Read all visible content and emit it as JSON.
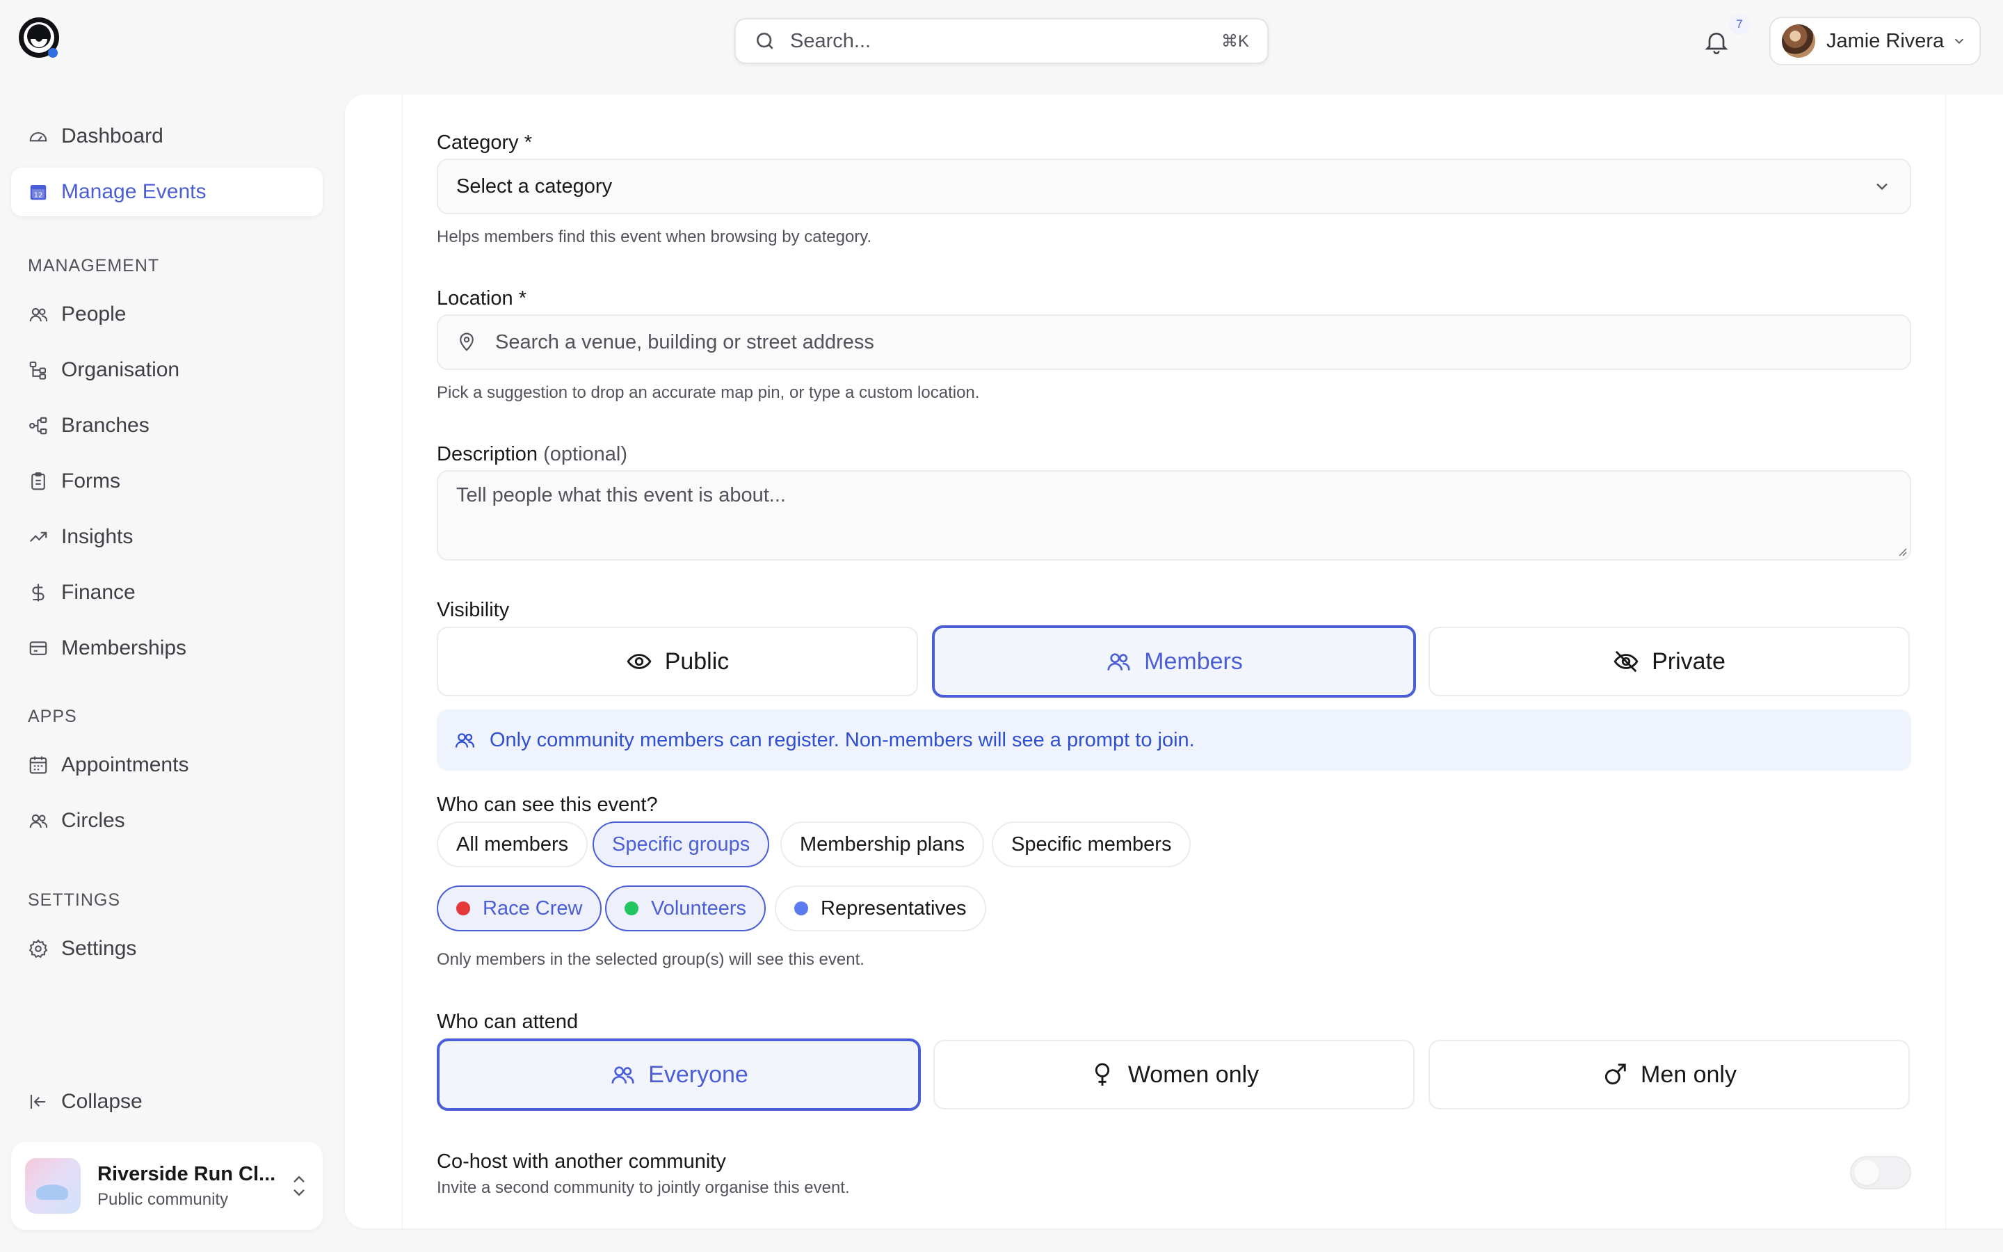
{
  "search": {
    "placeholder": "Search...",
    "shortcut": "⌘K"
  },
  "notifications": {
    "count": "7"
  },
  "user": {
    "name": "Jamie Rivera"
  },
  "sidebar": {
    "items_top": [
      {
        "label": "Dashboard",
        "icon": "gauge-icon"
      },
      {
        "label": "Manage Events",
        "icon": "calendar-icon",
        "active": true
      }
    ],
    "management": {
      "title": "MANAGEMENT",
      "items": [
        {
          "label": "People",
          "icon": "users-icon"
        },
        {
          "label": "Organisation",
          "icon": "org-tree-icon"
        },
        {
          "label": "Branches",
          "icon": "branches-icon"
        },
        {
          "label": "Forms",
          "icon": "clipboard-icon"
        },
        {
          "label": "Insights",
          "icon": "trending-up-icon"
        },
        {
          "label": "Finance",
          "icon": "dollar-icon"
        },
        {
          "label": "Memberships",
          "icon": "card-icon"
        }
      ]
    },
    "apps": {
      "title": "APPS",
      "items": [
        {
          "label": "Appointments",
          "icon": "calendar-grid-icon"
        },
        {
          "label": "Circles",
          "icon": "users-icon"
        }
      ]
    },
    "settings": {
      "title": "SETTINGS",
      "items": [
        {
          "label": "Settings",
          "icon": "gear-icon"
        }
      ]
    },
    "collapse_label": "Collapse",
    "community": {
      "name": "Riverside Run Cl...",
      "subtitle": "Public community"
    }
  },
  "form": {
    "category": {
      "label": "Category *",
      "value": "Select a category",
      "help": "Helps members find this event when browsing by category."
    },
    "location": {
      "label": "Location *",
      "placeholder": "Search a venue, building or street address",
      "help": "Pick a suggestion to drop an accurate map pin, or type a custom location."
    },
    "description": {
      "label": "Description",
      "optional": "(optional)",
      "placeholder": "Tell people what this event is about..."
    },
    "visibility": {
      "label": "Visibility",
      "options": [
        "Public",
        "Members",
        "Private"
      ],
      "selected": "Members",
      "info": "Only community members can register. Non-members will see a prompt to join."
    },
    "who_can_see": {
      "label": "Who can see this event?",
      "options": [
        "All members",
        "Specific groups",
        "Membership plans",
        "Specific members"
      ],
      "selected": "Specific groups",
      "groups": [
        {
          "name": "Race Crew",
          "color": "#e5383b",
          "selected": true
        },
        {
          "name": "Volunteers",
          "color": "#22c55e",
          "selected": true
        },
        {
          "name": "Representatives",
          "color": "#5b7cf0",
          "selected": false
        }
      ],
      "help": "Only members in the selected group(s) will see this event."
    },
    "who_can_attend": {
      "label": "Who can attend",
      "options": [
        "Everyone",
        "Women only",
        "Men only"
      ],
      "selected": "Everyone"
    },
    "cohost": {
      "label": "Co-host with another community",
      "help": "Invite a second community to jointly organise this event.",
      "enabled": false
    }
  },
  "colors": {
    "accent": "#4b5ed6",
    "info_bg": "#eef3fd"
  }
}
